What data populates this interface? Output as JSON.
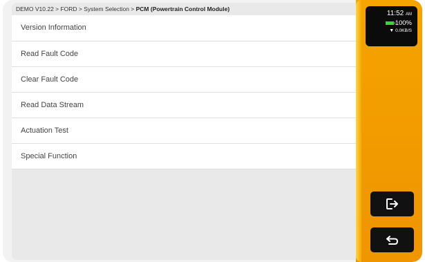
{
  "breadcrumb": {
    "path": "DEMO V10.22 > FORD > System Selection > ",
    "current": "PCM (Powertrain Control Module)"
  },
  "menu": {
    "items": [
      {
        "label": "Version Information"
      },
      {
        "label": "Read Fault Code"
      },
      {
        "label": "Clear Fault Code"
      },
      {
        "label": "Read Data Stream"
      },
      {
        "label": "Actuation Test"
      },
      {
        "label": "Special Function"
      }
    ]
  },
  "status": {
    "time": "11:52",
    "ampm": "AM",
    "battery": "100%",
    "network_speed": "0.0KB/S"
  },
  "sidebar": {
    "exit_icon": "exit-icon",
    "back_icon": "back-icon"
  },
  "colors": {
    "sidebar_orange": "#f39c00",
    "battery_green": "#3ed33e"
  }
}
